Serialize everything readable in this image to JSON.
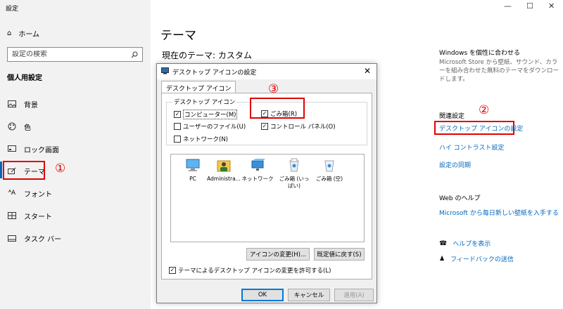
{
  "app": {
    "title": "設定"
  },
  "window_controls": {
    "minimize": "—",
    "maximize": "☐",
    "close": "✕"
  },
  "sidebar": {
    "home_label": "ホーム",
    "search_placeholder": "設定の検索",
    "section_label": "個人用設定",
    "items": [
      {
        "label": "背景",
        "icon": "image-icon"
      },
      {
        "label": "色",
        "icon": "palette-icon"
      },
      {
        "label": "ロック画面",
        "icon": "lock-screen-icon"
      },
      {
        "label": "テーマ",
        "icon": "brush-icon",
        "active": true
      },
      {
        "label": "フォント",
        "icon": "font-icon"
      },
      {
        "label": "スタート",
        "icon": "start-icon"
      },
      {
        "label": "タスク バー",
        "icon": "taskbar-icon"
      }
    ]
  },
  "main": {
    "title": "テーマ",
    "current_theme": "現在のテーマ: カスタム"
  },
  "right_pane": {
    "personalize_title": "Windows を個性に合わせる",
    "personalize_desc": "Microsoft Store から壁紙、サウンド、カラーを組み合わせた無料のテーマをダウンロードします。",
    "related_title": "関連設定",
    "links": [
      "デスクトップ アイコンの設定",
      "ハイ コントラスト設定",
      "設定の同期"
    ],
    "web_help_title": "Web のヘルプ",
    "web_help_link": "Microsoft から毎日新しい壁紙を入手する",
    "help_link": "ヘルプを表示",
    "feedback_link": "フィードバックの送信"
  },
  "annotations": {
    "one": "①",
    "two": "②",
    "three": "③"
  },
  "dialog": {
    "title": "デスクトップ アイコンの設定",
    "close": "✕",
    "tab": "デスクトップ アイコン",
    "group_title": "デスクトップ アイコン",
    "checkboxes": [
      {
        "label": "コンピューター(M)",
        "checked": true
      },
      {
        "label": "ごみ箱(R)",
        "checked": true
      },
      {
        "label": "ユーザーのファイル(U)",
        "checked": false
      },
      {
        "label": "コントロール パネル(O)",
        "checked": true
      },
      {
        "label": "ネットワーク(N)",
        "checked": false
      }
    ],
    "icons": [
      {
        "label": "PC",
        "icon": "pc-icon"
      },
      {
        "label": "Administra...",
        "icon": "user-folder-icon"
      },
      {
        "label": "ネットワーク",
        "icon": "network-icon"
      },
      {
        "label": "ごみ箱 (いっぱい)",
        "icon": "recycle-bin-full-icon"
      },
      {
        "label": "ごみ箱 (空)",
        "icon": "recycle-bin-empty-icon"
      }
    ],
    "change_icon_button": "アイコンの変更(H)...",
    "restore_default_button": "既定値に戻す(S)",
    "allow_themes_label": "テーマによるデスクトップ アイコンの変更を許可する(L)",
    "allow_themes_checked": true,
    "ok_button": "OK",
    "cancel_button": "キャンセル",
    "apply_button": "適用(A)"
  },
  "colors": {
    "accent": "#0067c0",
    "annotation_red": "#e00000"
  }
}
